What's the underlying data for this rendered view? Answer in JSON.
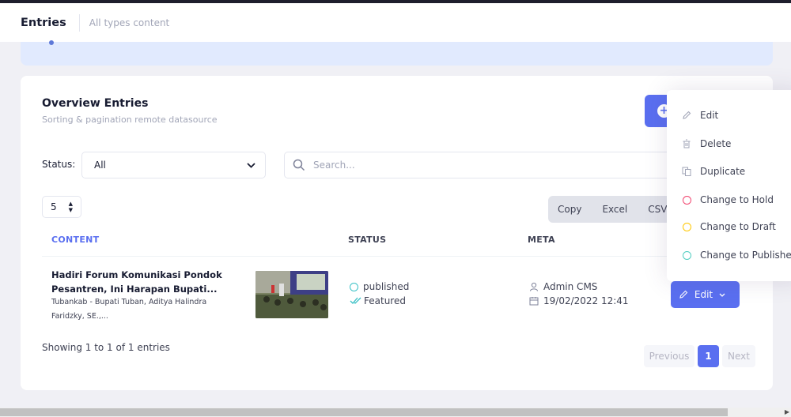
{
  "header": {
    "title": "Entries",
    "subtitle": "All types content"
  },
  "card": {
    "title": "Overview Entries",
    "subtitle": "Sorting & pagination remote datasource",
    "add_label": "+"
  },
  "filters": {
    "status_label": "Status:",
    "status_value": "All",
    "search_placeholder": "Search..."
  },
  "table": {
    "page_size": "5",
    "export_buttons": [
      "Copy",
      "Excel",
      "CSV"
    ],
    "columns": {
      "content": "CONTENT",
      "status": "STATUS",
      "meta": "META"
    },
    "rows": [
      {
        "title": "Hadiri Forum Komunikasi Pondok Pesantren, Ini Harapan Bupati...",
        "description": "Tubankab - Bupati Tuban, Aditya Halindra Faridzky, SE.,...",
        "status": "published",
        "featured": "Featured",
        "author": "Admin CMS",
        "date": "19/02/2022 12:41",
        "action_label": "Edit"
      }
    ],
    "showing": "Showing 1 to 1 of 1 entries",
    "pagination": {
      "previous": "Previous",
      "current": "1",
      "next": "Next"
    }
  },
  "menu": {
    "items": [
      {
        "label": "Edit",
        "icon": "pencil-icon"
      },
      {
        "label": "Delete",
        "icon": "trash-icon"
      },
      {
        "label": "Duplicate",
        "icon": "copy-icon"
      },
      {
        "label": "Change to Hold",
        "icon": "circle-icon",
        "color": "#f1416c"
      },
      {
        "label": "Change to Draft",
        "icon": "circle-icon",
        "color": "#ffc700"
      },
      {
        "label": "Change to Publishe",
        "icon": "circle-icon",
        "color": "#50cdc0"
      }
    ]
  },
  "colors": {
    "primary": "#5a6ff0",
    "published": "#3bc1c6"
  }
}
